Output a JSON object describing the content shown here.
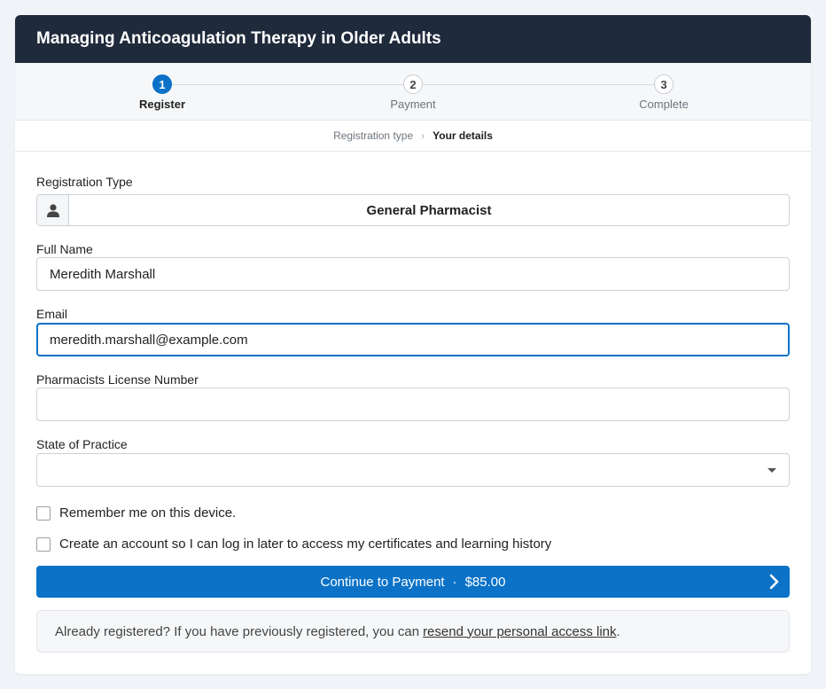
{
  "header": {
    "title": "Managing Anticoagulation Therapy in Older Adults"
  },
  "stepper": {
    "steps": [
      {
        "number": "1",
        "label": "Register"
      },
      {
        "number": "2",
        "label": "Payment"
      },
      {
        "number": "3",
        "label": "Complete"
      }
    ],
    "active_step": 1
  },
  "breadcrumb": {
    "items": [
      "Registration type",
      "Your details"
    ]
  },
  "form": {
    "registration_type": {
      "label": "Registration Type",
      "value": "General Pharmacist",
      "icon": "user-icon"
    },
    "full_name": {
      "label": "Full Name",
      "value": "Meredith Marshall"
    },
    "email": {
      "label": "Email",
      "value": "meredith.marshall@example.com"
    },
    "license": {
      "label": "Pharmacists License Number",
      "value": ""
    },
    "state": {
      "label": "State of Practice",
      "value": ""
    },
    "remember_label": "Remember me on this device.",
    "create_account_label": "Create an account so I can log in later to access my certificates and learning history"
  },
  "continue_button": {
    "label": "Continue to Payment",
    "separator": "·",
    "price": "$85.00"
  },
  "notice": {
    "text": "Already registered? If you have previously registered, you can",
    "link": "resend your personal access link",
    "end": "."
  },
  "colors": {
    "primary": "#0b72c7",
    "header_bg": "#1f2a3b"
  }
}
